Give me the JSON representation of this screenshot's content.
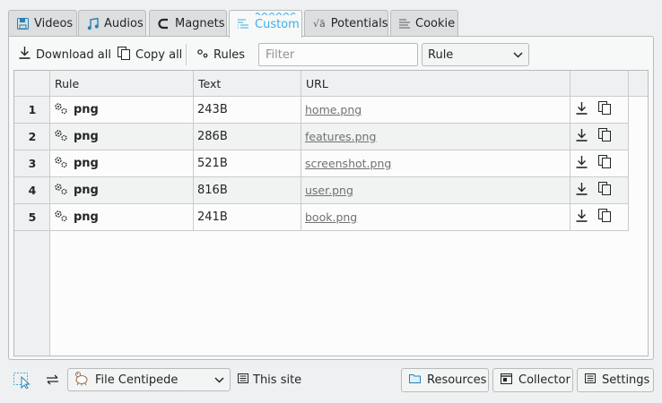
{
  "tabs": [
    {
      "label": "Videos",
      "icon": "floppy-icon"
    },
    {
      "label": "Audios",
      "icon": "music-note-icon"
    },
    {
      "label": "Magnets",
      "icon": "magnet-icon"
    },
    {
      "label": "Custom",
      "icon": "custom-list-icon",
      "active": true
    },
    {
      "label": "Potentials",
      "icon": "sqrt-icon"
    },
    {
      "label": "Cookie",
      "icon": "text-lines-icon"
    }
  ],
  "toolbar": {
    "download_all": "Download all",
    "copy_all": "Copy all",
    "rules": "Rules",
    "filter_placeholder": "Filter",
    "filter_value": "",
    "rule_select": "Rule"
  },
  "table": {
    "headers": [
      "Rule",
      "Text",
      "URL"
    ],
    "rows": [
      {
        "num": "1",
        "rule": "png",
        "text": "243B",
        "url": "home.png"
      },
      {
        "num": "2",
        "rule": "png",
        "text": "286B",
        "url": "features.png"
      },
      {
        "num": "3",
        "rule": "png",
        "text": "521B",
        "url": "screenshot.png"
      },
      {
        "num": "4",
        "rule": "png",
        "text": "816B",
        "url": "user.png"
      },
      {
        "num": "5",
        "rule": "png",
        "text": "241B",
        "url": "book.png"
      }
    ]
  },
  "bottom": {
    "profile_select": "File Centipede",
    "this_site": "This site",
    "resources": "Resources",
    "collector": "Collector",
    "settings": "Settings"
  },
  "colors": {
    "accent": "#3daee9",
    "window_bg": "#eff0f1",
    "border": "#b8bbbd"
  }
}
